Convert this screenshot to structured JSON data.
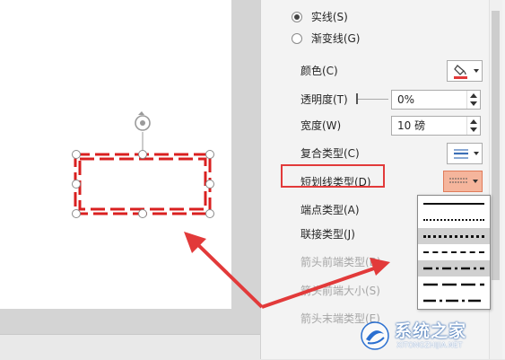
{
  "pane": {
    "radio_options": [
      {
        "label": "实线(S)",
        "checked": true
      },
      {
        "label": "渐变线(G)",
        "checked": false
      }
    ],
    "fields": {
      "color": "颜色(C)",
      "transparency": "透明度(T)",
      "transparency_value": "0%",
      "width": "宽度(W)",
      "width_value": "10 磅",
      "compound_type": "复合类型(C)",
      "dash_type": "短划线类型(D)",
      "cap_type": "端点类型(A)",
      "join_type": "联接类型(J)",
      "arrow_begin_type": "箭头前端类型(B)",
      "arrow_begin_size": "箭头前端大小(S)",
      "arrow_end_type": "箭头末端类型(E)"
    }
  },
  "watermark": {
    "brand": "系统之家",
    "url": "XITONGZHIJIA.NET"
  },
  "colors": {
    "accent_red": "#e23a3a",
    "shape_dash_red": "#d92020",
    "dash_button_bg": "#f5b59c"
  },
  "icons": {
    "rotate": "rotate-icon",
    "paint_bucket": "paint-bucket-icon",
    "compound_lines": "compound-lines-icon",
    "dash_preview": "dash-preview-icon"
  }
}
